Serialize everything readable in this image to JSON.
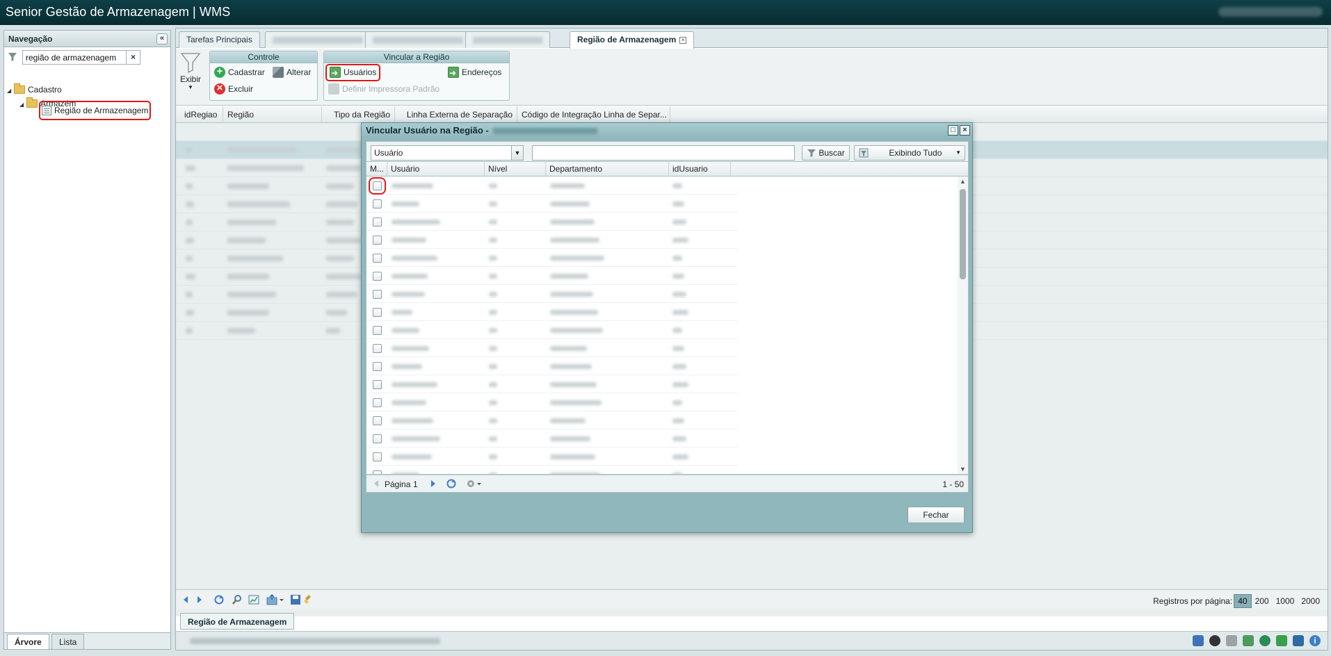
{
  "app": {
    "title": "Senior Gestão de Armazenagem | WMS"
  },
  "navigation": {
    "header": "Navegação",
    "filter_value": "região de armazenagem",
    "tree": {
      "root": "Cadastro",
      "child": "Armazém",
      "leaf": "Região de Armazenagem"
    },
    "tabs": [
      "Árvore",
      "Lista"
    ]
  },
  "tabs": {
    "first": "Tarefas Principais",
    "active": "Região de Armazenagem"
  },
  "toolbar": {
    "exibir": "Exibir",
    "controle": {
      "title": "Controle",
      "cadastrar": "Cadastrar",
      "alterar": "Alterar",
      "excluir": "Excluir"
    },
    "vincular": {
      "title": "Vincular a Região",
      "usuarios": "Usuários",
      "enderecos": "Endereços",
      "impressora": "Definir Impressora Padrão"
    }
  },
  "grid": {
    "columns": [
      "idRegiao",
      "Região",
      "Tipo da Região",
      "Linha Externa de Separação",
      "Código de Integração Linha de Separ..."
    ],
    "records_per_page_label": "Registros por página:",
    "page_sizes": [
      "40",
      "200",
      "1000",
      "2000"
    ],
    "selected_page_size": "40"
  },
  "bottom_tab": "Região de Armazenagem",
  "modal": {
    "title": "Vincular Usuário na Região -",
    "search_field": "Usuário",
    "search_value": "",
    "search_button": "Buscar",
    "filter_button": "Exibindo Tudo",
    "columns": [
      "M...",
      "Usuário",
      "Nível",
      "Departamento",
      "idUsuario"
    ],
    "row_count": 17,
    "paging": {
      "page_label": "Página",
      "page": "1",
      "range": "1 - 50"
    },
    "close_button": "Fechar"
  }
}
